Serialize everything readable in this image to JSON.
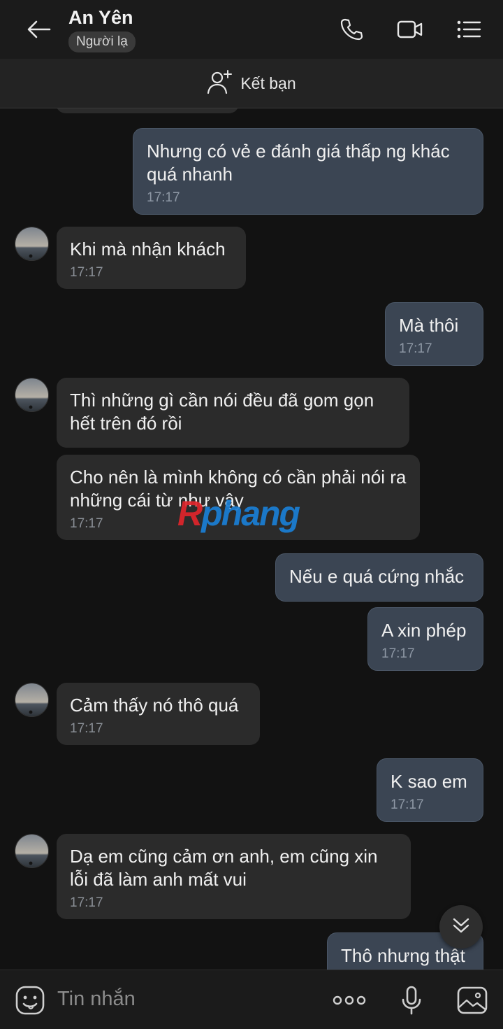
{
  "header": {
    "contact_name": "An Yên",
    "badge": "Người lạ",
    "icons": [
      "back-arrow-icon",
      "phone-icon",
      "video-call-icon",
      "menu-list-icon"
    ]
  },
  "friend_bar": {
    "label": "Kết bạn",
    "icon": "add-friend-icon"
  },
  "watermark": {
    "text_part1": "R",
    "text_part2": "phang",
    "color1": "#e0252b",
    "color2": "#1a7fd6"
  },
  "messages": [
    {
      "dir": "out",
      "text": "Nhưng có vẻ e đánh giá thấp ng khác quá nhanh",
      "time": "17:17"
    },
    {
      "dir": "in",
      "text": "Khi mà nhận khách",
      "time": "17:17"
    },
    {
      "dir": "out",
      "text": "Mà thôi",
      "time": "17:17"
    },
    {
      "dir": "in",
      "text": "Thì những gì cần nói đều đã gom gọn hết trên đó rồi",
      "time": ""
    },
    {
      "dir": "in",
      "text": "Cho nên là mình không có cần phải nói ra những cái từ như vậy",
      "time": "17:17"
    },
    {
      "dir": "out",
      "text": "Nếu e quá cứng nhắc",
      "time": ""
    },
    {
      "dir": "out",
      "text": "A xin phép",
      "time": "17:17"
    },
    {
      "dir": "in",
      "text": "Cảm thấy nó thô quá",
      "time": "17:17"
    },
    {
      "dir": "out",
      "text": "K sao em",
      "time": "17:17"
    },
    {
      "dir": "in",
      "text": "Dạ em cũng cảm ơn anh, em cũng xin lỗi đã làm anh mất vui",
      "time": "17:17"
    },
    {
      "dir": "out",
      "text": "Thô nhưng thật",
      "time": ""
    }
  ],
  "input": {
    "placeholder": "Tin nhắn",
    "icons": [
      "sticker-icon",
      "more-dots-icon",
      "microphone-icon",
      "image-gallery-icon"
    ]
  },
  "colors": {
    "background": "#121212",
    "bubble_in": "#2b2b2b",
    "bubble_out": "#3b4553"
  }
}
